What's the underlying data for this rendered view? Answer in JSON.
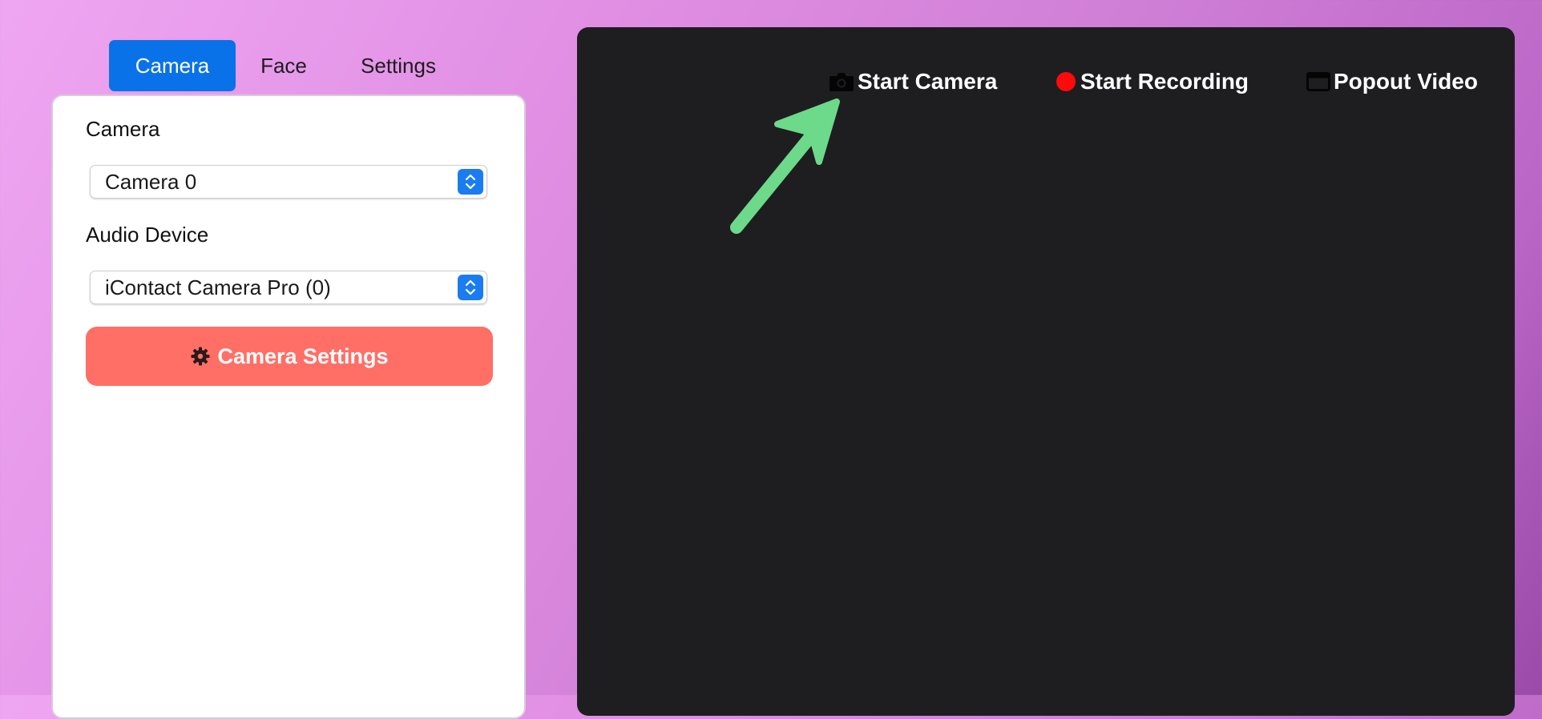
{
  "tabs": [
    {
      "label": "Camera",
      "active": true
    },
    {
      "label": "Face",
      "active": false
    },
    {
      "label": "Settings",
      "active": false
    }
  ],
  "panel": {
    "camera_label": "Camera",
    "camera_value": "Camera 0",
    "audio_label": "Audio Device",
    "audio_value": "iContact Camera Pro (0)",
    "settings_button": "Camera Settings"
  },
  "video": {
    "start_camera": "Start Camera",
    "start_recording": "Start Recording",
    "popout_video": "Popout Video"
  },
  "colors": {
    "accent": "#0a72e8",
    "settings_button": "#ff6f66",
    "recording": "#ff0a0a",
    "annotation_arrow": "#6dd98a",
    "video_bg": "#1e1e20"
  },
  "icons": {
    "camera": "camera-icon",
    "record": "record-dot-icon",
    "popout": "window-icon",
    "gear": "gear-icon",
    "stepper": "chevron-up-down-icon"
  }
}
